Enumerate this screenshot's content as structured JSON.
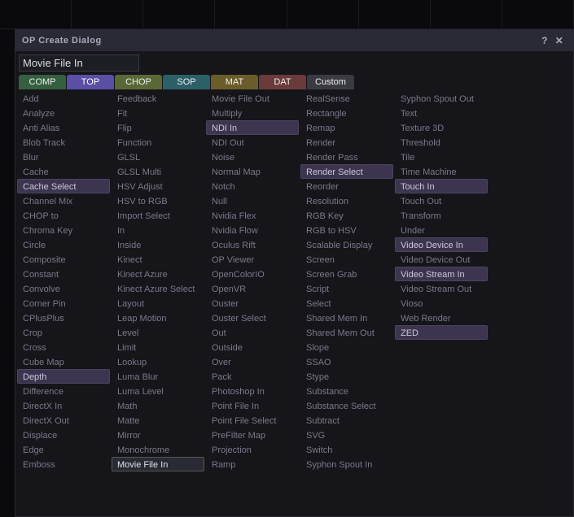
{
  "dialog": {
    "title": "OP Create Dialog",
    "help": "?",
    "close": "✕"
  },
  "search": {
    "value": "Movie File In"
  },
  "tabs": [
    {
      "label": "COMP",
      "cls": "tab-comp"
    },
    {
      "label": "TOP",
      "cls": "tab-top"
    },
    {
      "label": "CHOP",
      "cls": "tab-chop"
    },
    {
      "label": "SOP",
      "cls": "tab-sop"
    },
    {
      "label": "MAT",
      "cls": "tab-mat"
    },
    {
      "label": "DAT",
      "cls": "tab-dat"
    },
    {
      "label": "Custom",
      "cls": "tab-custom"
    }
  ],
  "columns": [
    [
      {
        "l": "Add"
      },
      {
        "l": "Analyze"
      },
      {
        "l": "Anti Alias"
      },
      {
        "l": "Blob Track"
      },
      {
        "l": "Blur"
      },
      {
        "l": "Cache"
      },
      {
        "l": "Cache Select",
        "hl": true
      },
      {
        "l": "Channel Mix"
      },
      {
        "l": "CHOP to"
      },
      {
        "l": "Chroma Key"
      },
      {
        "l": "Circle"
      },
      {
        "l": "Composite"
      },
      {
        "l": "Constant"
      },
      {
        "l": "Convolve"
      },
      {
        "l": "Corner Pin"
      },
      {
        "l": "CPlusPlus"
      },
      {
        "l": "Crop"
      },
      {
        "l": "Cross"
      },
      {
        "l": "Cube Map"
      },
      {
        "l": "Depth",
        "hl": true
      },
      {
        "l": "Difference"
      },
      {
        "l": "DirectX In"
      },
      {
        "l": "DirectX Out"
      },
      {
        "l": "Displace"
      },
      {
        "l": "Edge"
      },
      {
        "l": "Emboss"
      }
    ],
    [
      {
        "l": "Feedback"
      },
      {
        "l": "Fit"
      },
      {
        "l": "Flip"
      },
      {
        "l": "Function"
      },
      {
        "l": "GLSL"
      },
      {
        "l": "GLSL Multi"
      },
      {
        "l": "HSV Adjust"
      },
      {
        "l": "HSV to RGB"
      },
      {
        "l": "Import Select"
      },
      {
        "l": "In"
      },
      {
        "l": "Inside"
      },
      {
        "l": "Kinect"
      },
      {
        "l": "Kinect Azure"
      },
      {
        "l": "Kinect Azure Select"
      },
      {
        "l": "Layout"
      },
      {
        "l": "Leap Motion"
      },
      {
        "l": "Level"
      },
      {
        "l": "Limit"
      },
      {
        "l": "Lookup"
      },
      {
        "l": "Luma Blur"
      },
      {
        "l": "Luma Level"
      },
      {
        "l": "Math"
      },
      {
        "l": "Matte"
      },
      {
        "l": "Mirror"
      },
      {
        "l": "Monochrome"
      },
      {
        "l": "Movie File In",
        "sel": true
      }
    ],
    [
      {
        "l": "Movie File Out"
      },
      {
        "l": "Multiply"
      },
      {
        "l": "NDI In",
        "hl": true
      },
      {
        "l": "NDI Out"
      },
      {
        "l": "Noise"
      },
      {
        "l": "Normal Map"
      },
      {
        "l": "Notch"
      },
      {
        "l": "Null"
      },
      {
        "l": "Nvidia Flex"
      },
      {
        "l": "Nvidia Flow"
      },
      {
        "l": "Oculus Rift"
      },
      {
        "l": "OP Viewer"
      },
      {
        "l": "OpenColorIO"
      },
      {
        "l": "OpenVR"
      },
      {
        "l": "Ouster"
      },
      {
        "l": "Ouster Select"
      },
      {
        "l": "Out"
      },
      {
        "l": "Outside"
      },
      {
        "l": "Over"
      },
      {
        "l": "Pack"
      },
      {
        "l": "Photoshop In"
      },
      {
        "l": "Point File In"
      },
      {
        "l": "Point File Select"
      },
      {
        "l": "PreFilter Map"
      },
      {
        "l": "Projection"
      },
      {
        "l": "Ramp"
      }
    ],
    [
      {
        "l": "RealSense"
      },
      {
        "l": "Rectangle"
      },
      {
        "l": "Remap"
      },
      {
        "l": "Render"
      },
      {
        "l": "Render Pass"
      },
      {
        "l": "Render Select",
        "hl": true
      },
      {
        "l": "Reorder"
      },
      {
        "l": "Resolution"
      },
      {
        "l": "RGB Key"
      },
      {
        "l": "RGB to HSV"
      },
      {
        "l": "Scalable Display"
      },
      {
        "l": "Screen"
      },
      {
        "l": "Screen Grab"
      },
      {
        "l": "Script"
      },
      {
        "l": "Select"
      },
      {
        "l": "Shared Mem In"
      },
      {
        "l": "Shared Mem Out"
      },
      {
        "l": "Slope"
      },
      {
        "l": "SSAO"
      },
      {
        "l": "Stype"
      },
      {
        "l": "Substance"
      },
      {
        "l": "Substance Select"
      },
      {
        "l": "Subtract"
      },
      {
        "l": "SVG"
      },
      {
        "l": "Switch"
      },
      {
        "l": "Syphon Spout In"
      }
    ],
    [
      {
        "l": "Syphon Spout Out"
      },
      {
        "l": "Text"
      },
      {
        "l": "Texture 3D"
      },
      {
        "l": "Threshold"
      },
      {
        "l": "Tile"
      },
      {
        "l": "Time Machine"
      },
      {
        "l": "Touch In",
        "hl": true
      },
      {
        "l": "Touch Out"
      },
      {
        "l": "Transform"
      },
      {
        "l": "Under"
      },
      {
        "l": "Video Device In",
        "hl": true
      },
      {
        "l": "Video Device Out"
      },
      {
        "l": "Video Stream In",
        "hl": true
      },
      {
        "l": "Video Stream Out"
      },
      {
        "l": "Vioso"
      },
      {
        "l": "Web Render"
      },
      {
        "l": "ZED",
        "hl": true
      }
    ]
  ]
}
